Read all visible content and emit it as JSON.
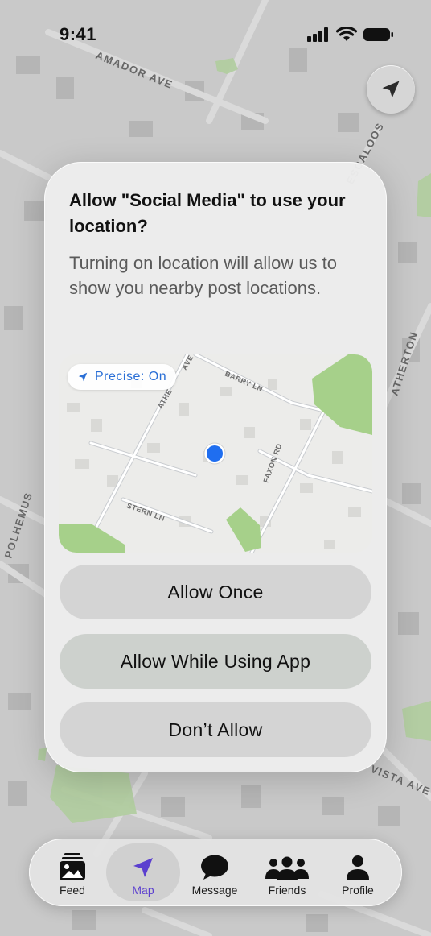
{
  "status_bar": {
    "time": "9:41",
    "icons": [
      "signal-icon",
      "wifi-icon",
      "battery-icon"
    ]
  },
  "map": {
    "street_labels": [
      "AMADOR AVE",
      "ESCALOOS",
      "ATHERTON",
      "POLHEMUS",
      "VISTA AVE"
    ]
  },
  "location_button": {
    "icon": "location-arrow-icon"
  },
  "dialog": {
    "title": "Allow \"Social Media\" to use your location?",
    "message": "Turning on location will allow us to show you nearby post locations.",
    "mini_map": {
      "street_labels": [
        "ATHE",
        "AVE",
        "BARRY LN",
        "FAXON RD",
        "STERN LN"
      ]
    },
    "precise": {
      "icon": "location-arrow-icon",
      "label": "Precise: On"
    },
    "buttons": {
      "allow_once": "Allow Once",
      "allow_while_using": "Allow While Using App",
      "dont_allow": "Don’t Allow"
    }
  },
  "tab_bar": {
    "active_tab": "Map",
    "accent_color": "#5b3fcf",
    "tabs": [
      {
        "label": "Feed",
        "icon": "photo-stack-icon"
      },
      {
        "label": "Map",
        "icon": "location-arrow-icon"
      },
      {
        "label": "Message",
        "icon": "chat-bubble-icon"
      },
      {
        "label": "Friends",
        "icon": "people-icon"
      },
      {
        "label": "Profile",
        "icon": "person-icon"
      }
    ]
  }
}
